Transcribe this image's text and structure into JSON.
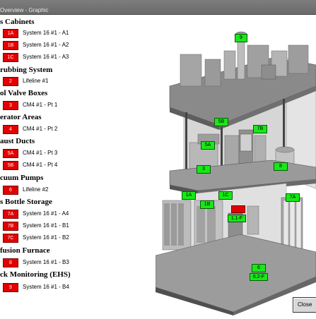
{
  "window": {
    "title": "Overview - Graphic"
  },
  "sections": [
    {
      "heading": "s Cabinets",
      "rows": [
        {
          "code": "1A",
          "label": "System 16 #1 - A1"
        },
        {
          "code": "1B",
          "label": "System 16 #1 - A2"
        },
        {
          "code": "1C",
          "label": "System 16 #1 - A3"
        }
      ]
    },
    {
      "heading": "rubbing System",
      "rows": [
        {
          "code": "2",
          "label": "Lifeline #1"
        }
      ]
    },
    {
      "heading": "ol Valve Boxes",
      "rows": [
        {
          "code": "3",
          "label": "CM4 #1 - Pt 1"
        }
      ]
    },
    {
      "heading": "erator Areas",
      "rows": [
        {
          "code": "4",
          "label": "CM4 #1 - Pt 2"
        }
      ]
    },
    {
      "heading": "aust Ducts",
      "rows": [
        {
          "code": "5A",
          "label": "CM4 #1 - Pt 3"
        },
        {
          "code": "5B",
          "label": "CM4 #1 - Pt 4"
        }
      ]
    },
    {
      "heading": "cuum Pumps",
      "rows": [
        {
          "code": "6",
          "label": "Lifeline #2"
        }
      ]
    },
    {
      "heading": "s Bottle Storage",
      "rows": [
        {
          "code": "7A",
          "label": "System 16 #1 - A4"
        },
        {
          "code": "7B",
          "label": "System 16 #1 - B1"
        },
        {
          "code": "7C",
          "label": "System 16 #1 - B2"
        }
      ]
    },
    {
      "heading": "fusion Furnace",
      "rows": [
        {
          "code": "8",
          "label": "System 16 #1 - B3"
        }
      ]
    },
    {
      "heading": "ck Monitoring (EHS)",
      "rows": [
        {
          "code": "9",
          "label": "System 16 #1 - B4"
        }
      ]
    }
  ],
  "scene_tags": {
    "t9": "9",
    "t5b": "5B",
    "t7b": "7B",
    "t5a": "5A",
    "t8": "8",
    "t3": "3",
    "t1a": "1A",
    "t1c": "1C",
    "t1b": "1B",
    "t7a": "7A",
    "t6": "6",
    "t11": "1.1-F",
    "t62": "6.2-F"
  },
  "colors": {
    "alarm": "#e30000",
    "ok": "#18e818",
    "titlebar": "#767676"
  },
  "buttons": {
    "close": "Close"
  }
}
